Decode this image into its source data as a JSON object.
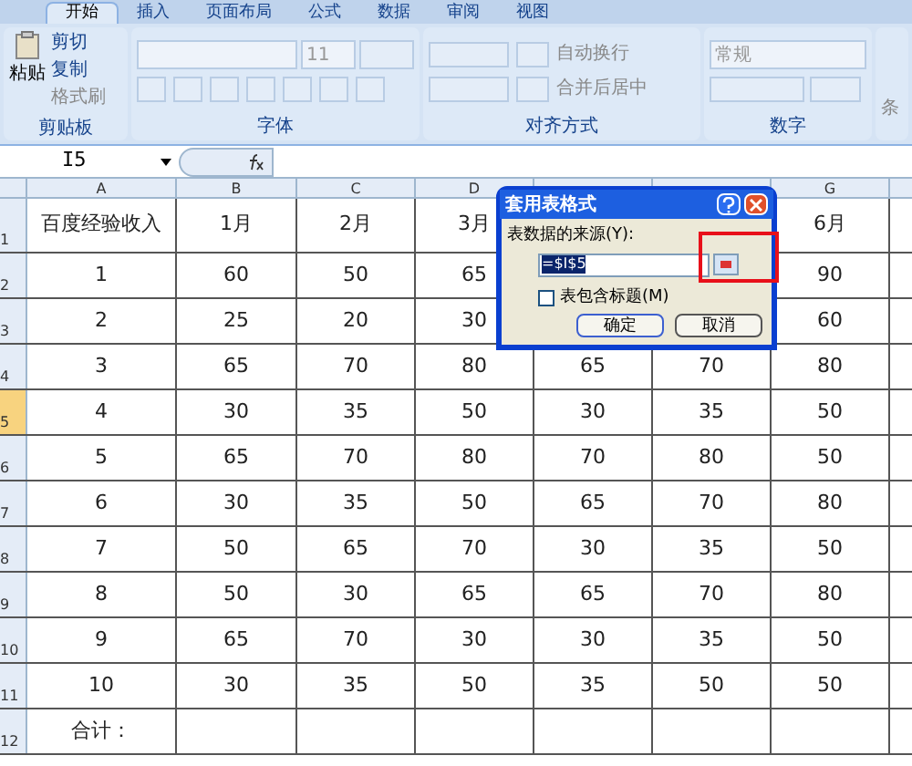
{
  "ribbon": {
    "tabs": [
      {
        "label": "开始",
        "selected": true
      },
      {
        "label": "插入",
        "selected": false
      },
      {
        "label": "页面布局",
        "selected": false
      },
      {
        "label": "公式",
        "selected": false
      },
      {
        "label": "数据",
        "selected": false
      },
      {
        "label": "审阅",
        "selected": false
      },
      {
        "label": "视图",
        "selected": false
      }
    ],
    "clipboard": {
      "paste": "粘贴",
      "actions": [
        "剪切",
        "复制",
        "格式刷"
      ],
      "title": "剪贴板"
    },
    "font": {
      "size": "11",
      "title": "字体"
    },
    "alignment": {
      "wrap": "自动换行",
      "merge": "合并后居中",
      "title": "对齐方式"
    },
    "number": {
      "format": "常规",
      "title": "数字"
    },
    "styles": {
      "partial": "条"
    }
  },
  "formula_bar": {
    "name_box": "I5"
  },
  "sheet": {
    "columns": [
      "A",
      "B",
      "C",
      "D",
      null,
      null,
      "G"
    ],
    "rows": [
      {
        "number": "1",
        "selected": false,
        "cells": [
          "百度经验收入",
          "1月",
          "2月",
          "3月",
          null,
          null,
          "6月"
        ]
      },
      {
        "number": "2",
        "selected": false,
        "cells": [
          "1",
          "60",
          "50",
          "65",
          null,
          null,
          "90"
        ]
      },
      {
        "number": "3",
        "selected": false,
        "cells": [
          "2",
          "25",
          "20",
          "30",
          null,
          null,
          "60"
        ]
      },
      {
        "number": "4",
        "selected": false,
        "cells": [
          "3",
          "65",
          "70",
          "80",
          "65",
          "70",
          "80"
        ]
      },
      {
        "number": "5",
        "selected": true,
        "cells": [
          "4",
          "30",
          "35",
          "50",
          "30",
          "35",
          "50"
        ]
      },
      {
        "number": "6",
        "selected": false,
        "cells": [
          "5",
          "65",
          "70",
          "80",
          "70",
          "80",
          "50"
        ]
      },
      {
        "number": "7",
        "selected": false,
        "cells": [
          "6",
          "30",
          "35",
          "50",
          "65",
          "70",
          "80"
        ]
      },
      {
        "number": "8",
        "selected": false,
        "cells": [
          "7",
          "50",
          "65",
          "70",
          "30",
          "35",
          "50"
        ]
      },
      {
        "number": "9",
        "selected": false,
        "cells": [
          "8",
          "50",
          "30",
          "65",
          "65",
          "70",
          "80"
        ]
      },
      {
        "number": "10",
        "selected": false,
        "cells": [
          "9",
          "65",
          "70",
          "30",
          "30",
          "35",
          "50"
        ]
      },
      {
        "number": "11",
        "selected": false,
        "cells": [
          "10",
          "30",
          "35",
          "50",
          "35",
          "50",
          "50"
        ]
      },
      {
        "number": "12",
        "selected": false,
        "cells": [
          "合计：",
          null,
          null,
          null,
          null,
          null,
          null
        ]
      }
    ]
  },
  "dialog": {
    "title": "套用表格式",
    "source_label": "表数据的来源(Y):",
    "source_value": "=$I$5",
    "range_button": {
      "highlighted": true
    },
    "has_headers": {
      "label": "表包含标题(M)",
      "checked": false
    },
    "buttons": [
      "确定",
      "取消"
    ]
  }
}
